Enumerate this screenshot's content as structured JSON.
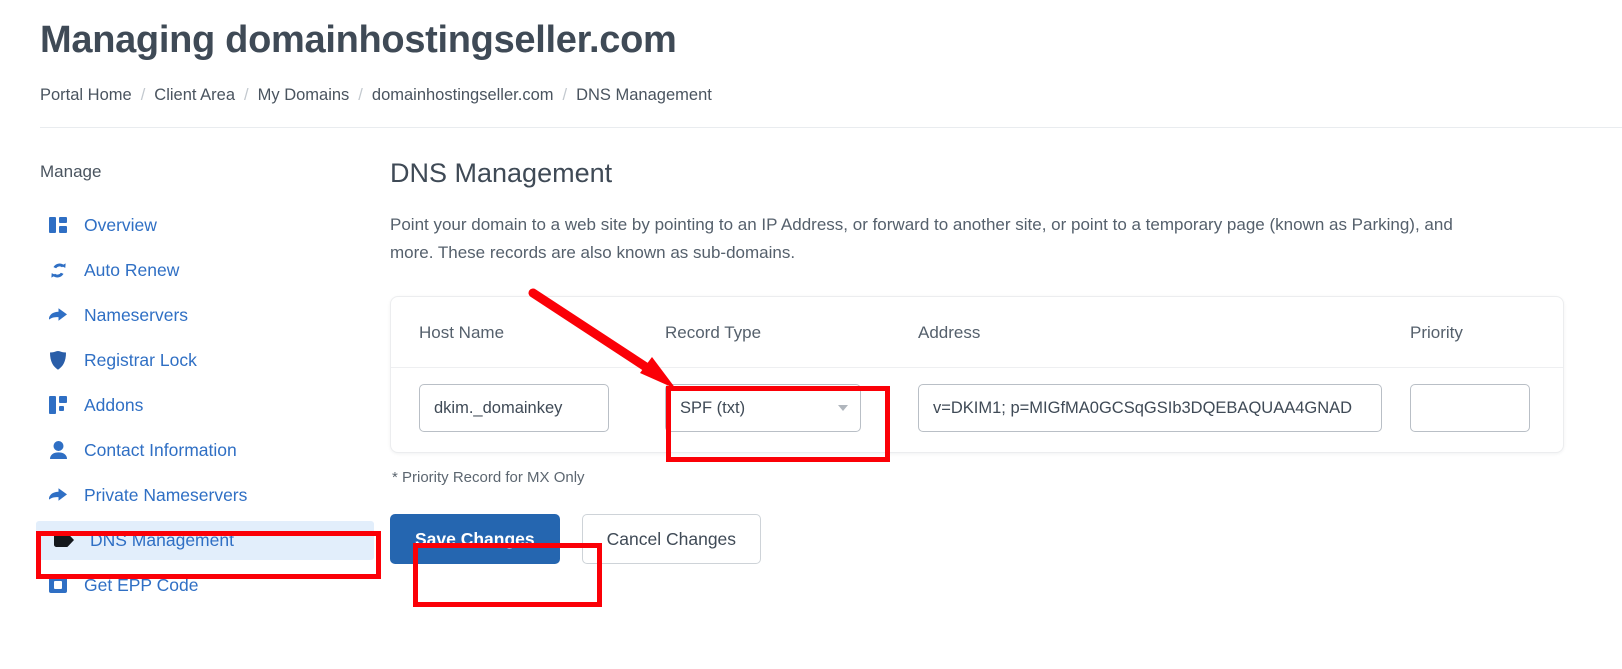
{
  "header": {
    "title": "Managing domainhostingseller.com",
    "breadcrumb": [
      {
        "label": "Portal Home"
      },
      {
        "label": "Client Area"
      },
      {
        "label": "My Domains"
      },
      {
        "label": "domainhostingseller.com"
      },
      {
        "label": "DNS Management"
      }
    ],
    "breadcrumb_separator": "/"
  },
  "sidebar": {
    "heading": "Manage",
    "items": [
      {
        "label": "Overview",
        "icon": "columns-icon",
        "active": false
      },
      {
        "label": "Auto Renew",
        "icon": "sync-icon",
        "active": false
      },
      {
        "label": "Nameservers",
        "icon": "arrow-right-icon",
        "active": false
      },
      {
        "label": "Registrar Lock",
        "icon": "shield-icon",
        "active": false
      },
      {
        "label": "Addons",
        "icon": "addons-icon",
        "active": false
      },
      {
        "label": "Contact Information",
        "icon": "user-icon",
        "active": false
      },
      {
        "label": "Private Nameservers",
        "icon": "arrow-right-icon",
        "active": false
      },
      {
        "label": "DNS Management",
        "icon": "tag-icon",
        "active": true
      },
      {
        "label": "Get EPP Code",
        "icon": "id-card-icon",
        "active": false
      }
    ]
  },
  "main": {
    "section_title": "DNS Management",
    "section_description": "Point your domain to a web site by pointing to an IP Address, or forward to another site, or point to a temporary page (known as Parking), and more. These records are also known as sub-domains.",
    "table": {
      "columns": [
        "Host Name",
        "Record Type",
        "Address",
        "Priority"
      ],
      "rows": [
        {
          "host_name": "dkim._domainkey",
          "record_type": "SPF (txt)",
          "address": "v=DKIM1; p=MIGfMA0GCSqGSIb3DQEBAQUAA4GNAD",
          "priority": ""
        }
      ]
    },
    "note": "* Priority Record for MX Only",
    "buttons": {
      "save": "Save Changes",
      "cancel": "Cancel Changes"
    }
  },
  "colors": {
    "link_blue": "#2f6fc4",
    "primary_button": "#2566b0",
    "annotation_red": "#fb0007",
    "active_item_background": "#e2eefb",
    "text_dark": "#3f4a56"
  }
}
